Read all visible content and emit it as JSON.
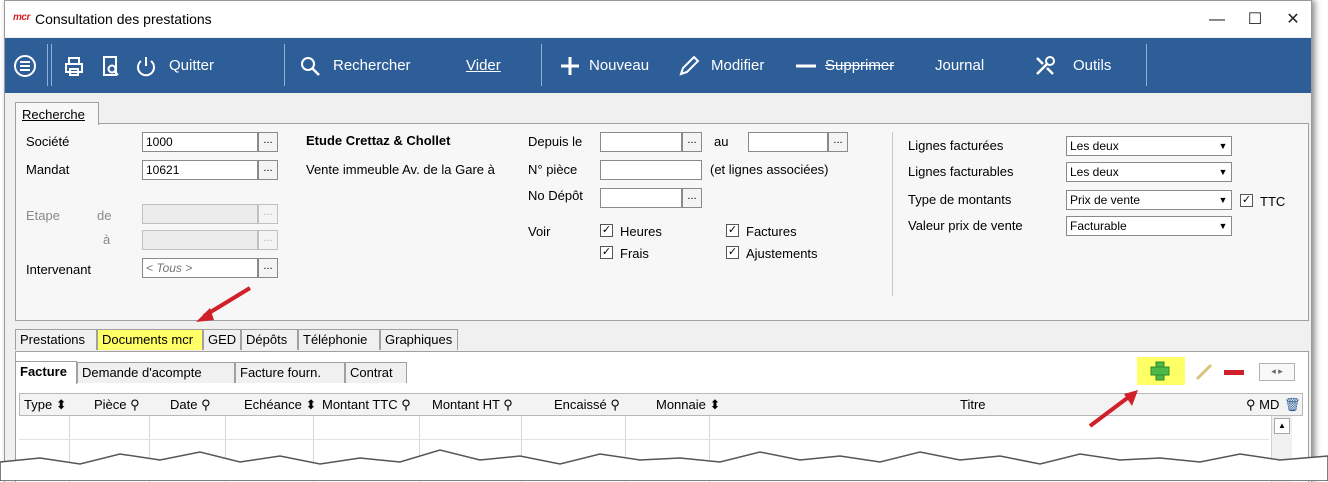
{
  "window": {
    "logo": "mcr",
    "title": "Consultation des prestations",
    "minimize": "—",
    "maximize": "☐",
    "close": "✕"
  },
  "toolbar": {
    "quit": "Quitter",
    "search": "Rechercher",
    "clear": "Vider",
    "new": "Nouveau",
    "edit": "Modifier",
    "delete": "Supprimer",
    "journal": "Journal",
    "tools": "Outils"
  },
  "search_tab": "Recherche",
  "form": {
    "societe_label": "Société",
    "societe_value": "1000",
    "mandat_label": "Mandat",
    "mandat_value": "10621",
    "company_name": "Etude Crettaz & Chollet",
    "mandat_desc": "Vente immeuble Av. de la Gare à",
    "etape_label": "Etape",
    "de_label": "de",
    "a_label": "à",
    "intervenant_label": "Intervenant",
    "intervenant_value": "< Tous >",
    "depuis_label": "Depuis le",
    "au_label": "au",
    "piece_label": "N° pièce",
    "piece_note": "(et lignes associées)",
    "depot_label": "No Dépôt",
    "voir_label": "Voir",
    "chk_heures": "Heures",
    "chk_factures": "Factures",
    "chk_frais": "Frais",
    "chk_ajustements": "Ajustements",
    "lignes_facturees_label": "Lignes facturées",
    "lignes_facturees_value": "Les deux",
    "lignes_facturables_label": "Lignes facturables",
    "lignes_facturables_value": "Les deux",
    "type_montants_label": "Type de montants",
    "type_montants_value": "Prix de vente",
    "ttc_label": "TTC",
    "valeur_prix_label": "Valeur prix de vente",
    "valeur_prix_value": "Facturable",
    "ellipsis": "..."
  },
  "main_tabs": [
    "Prestations",
    "Documents mcr",
    "GED",
    "Dépôts",
    "Téléphonie",
    "Graphiques"
  ],
  "sub_tabs": [
    "Facture",
    "Demande d'acompte",
    "Facture fourn.",
    "Contrat"
  ],
  "grid_columns": [
    "Type",
    "Pièce",
    "Date",
    "Echéance",
    "Montant TTC",
    "Montant HT",
    "Encaissé",
    "Monnaie",
    "Titre",
    "MD"
  ],
  "colors": {
    "toolbar": "#2e5e98",
    "highlight": "#ffff66",
    "arrow": "#d2202a",
    "add_icon": "#4cb848",
    "remove_icon": "#d2202a"
  }
}
